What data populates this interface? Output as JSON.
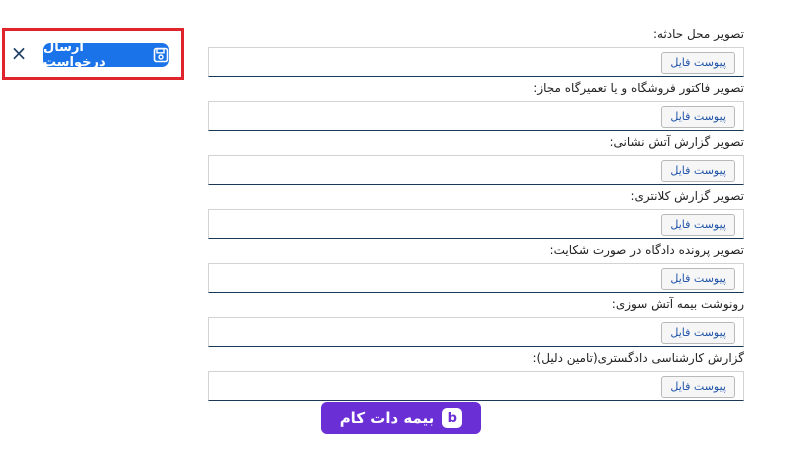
{
  "toolbar": {
    "close_icon": "close-icon",
    "close_glyph": "×",
    "submit_label": "ارسال درخواست",
    "submit_icon": "save-icon",
    "accent": "#1a73e8",
    "highlight": "#e0242c"
  },
  "upload_form": {
    "button_label": "پیوست فایل",
    "fields": [
      {
        "label": "تصویر محل حادثه:"
      },
      {
        "label": "تصویر فاکتور فروشگاه و یا تعمیرگاه مجاز:"
      },
      {
        "label": "تصویر گزارش آتش نشانی:"
      },
      {
        "label": "تصویر گزارش کلانتری:"
      },
      {
        "label": "تصویر پرونده دادگاه در صورت شکایت:"
      },
      {
        "label": "رونوشت بیمه آتش سوزی:"
      },
      {
        "label": "گزارش کارشناسی دادگستری(تامین دلیل):"
      }
    ]
  },
  "watermark": {
    "text": "بیمه دات کام",
    "color": "#6b2fd6"
  }
}
